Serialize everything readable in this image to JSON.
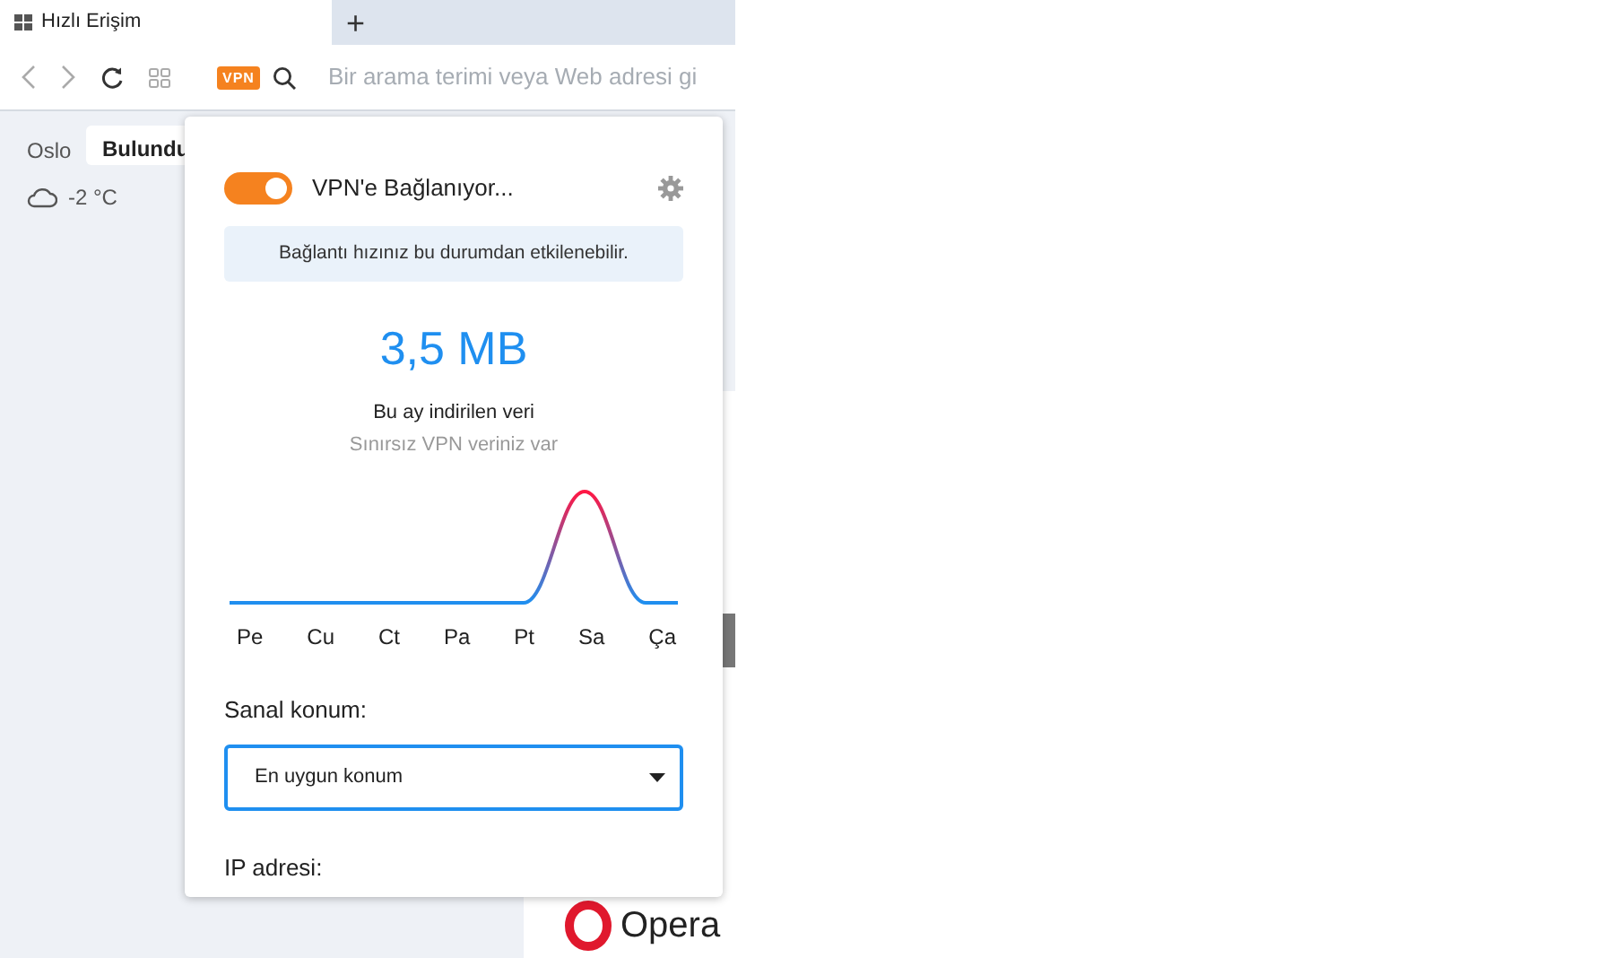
{
  "tabs": [
    {
      "label": "Hızlı Erişim",
      "selected": true
    }
  ],
  "new_tab_button": "+",
  "toolbar": {
    "vpn_badge": "VPN",
    "placeholder": "Bir arama terimi veya Web adresi gi"
  },
  "weather": {
    "city": "Oslo",
    "temperature": "-2 °C"
  },
  "tooltip": "Bulundu",
  "background_card": {
    "logo_text": "Opera"
  },
  "vpn_popup": {
    "toggle_on": true,
    "status": "VPN'e Bağlanıyor...",
    "notice": "Bağlantı hızınız bu durumdan etkilenebilir.",
    "data_amount": "3,5 MB",
    "data_label": "Bu ay indirilen veri",
    "data_note": "Sınırsız VPN veriniz var",
    "days": [
      "Pe",
      "Cu",
      "Ct",
      "Pa",
      "Pt",
      "Sa",
      "Ça"
    ],
    "location_label": "Sanal konum:",
    "location_value": "En uygun konum",
    "ip_label": "IP adresi:"
  }
}
